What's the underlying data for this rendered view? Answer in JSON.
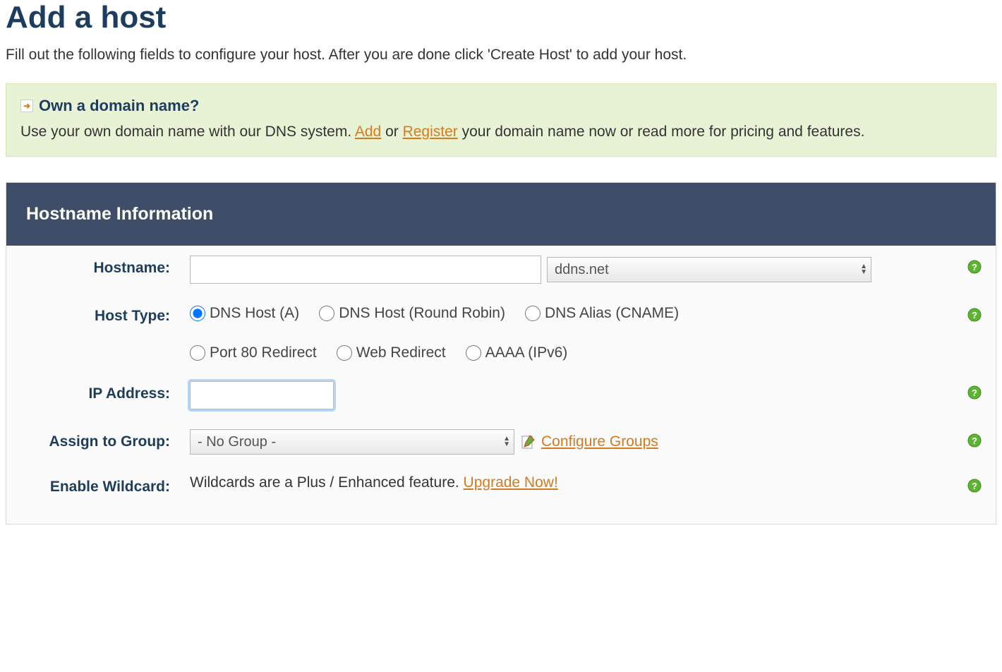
{
  "page": {
    "title": "Add a host",
    "intro": "Fill out the following fields to configure your host. After you are done click 'Create Host' to add your host."
  },
  "notice": {
    "heading": "Own a domain name?",
    "body_pre": "Use your own domain name with our DNS system. ",
    "link_add": "Add",
    "body_mid": " or ",
    "link_register": "Register",
    "body_post": " your domain name now or read more for pricing and features."
  },
  "panel": {
    "title": "Hostname Information"
  },
  "form": {
    "hostname": {
      "label": "Hostname:",
      "value": "",
      "domain_selected": "ddns.net"
    },
    "host_type": {
      "label": "Host Type:",
      "options": {
        "a": "DNS Host (A)",
        "rr": "DNS Host (Round Robin)",
        "cname": "DNS Alias (CNAME)",
        "port80": "Port 80 Redirect",
        "web": "Web Redirect",
        "aaaa": "AAAA (IPv6)"
      },
      "selected": "a"
    },
    "ip": {
      "label": "IP Address:",
      "value": ""
    },
    "group": {
      "label": "Assign to Group:",
      "selected": "- No Group -",
      "configure_link": "Configure Groups"
    },
    "wildcard": {
      "label": "Enable Wildcard:",
      "text": "Wildcards are a Plus / Enhanced feature. ",
      "upgrade_link": "Upgrade Now!"
    }
  }
}
